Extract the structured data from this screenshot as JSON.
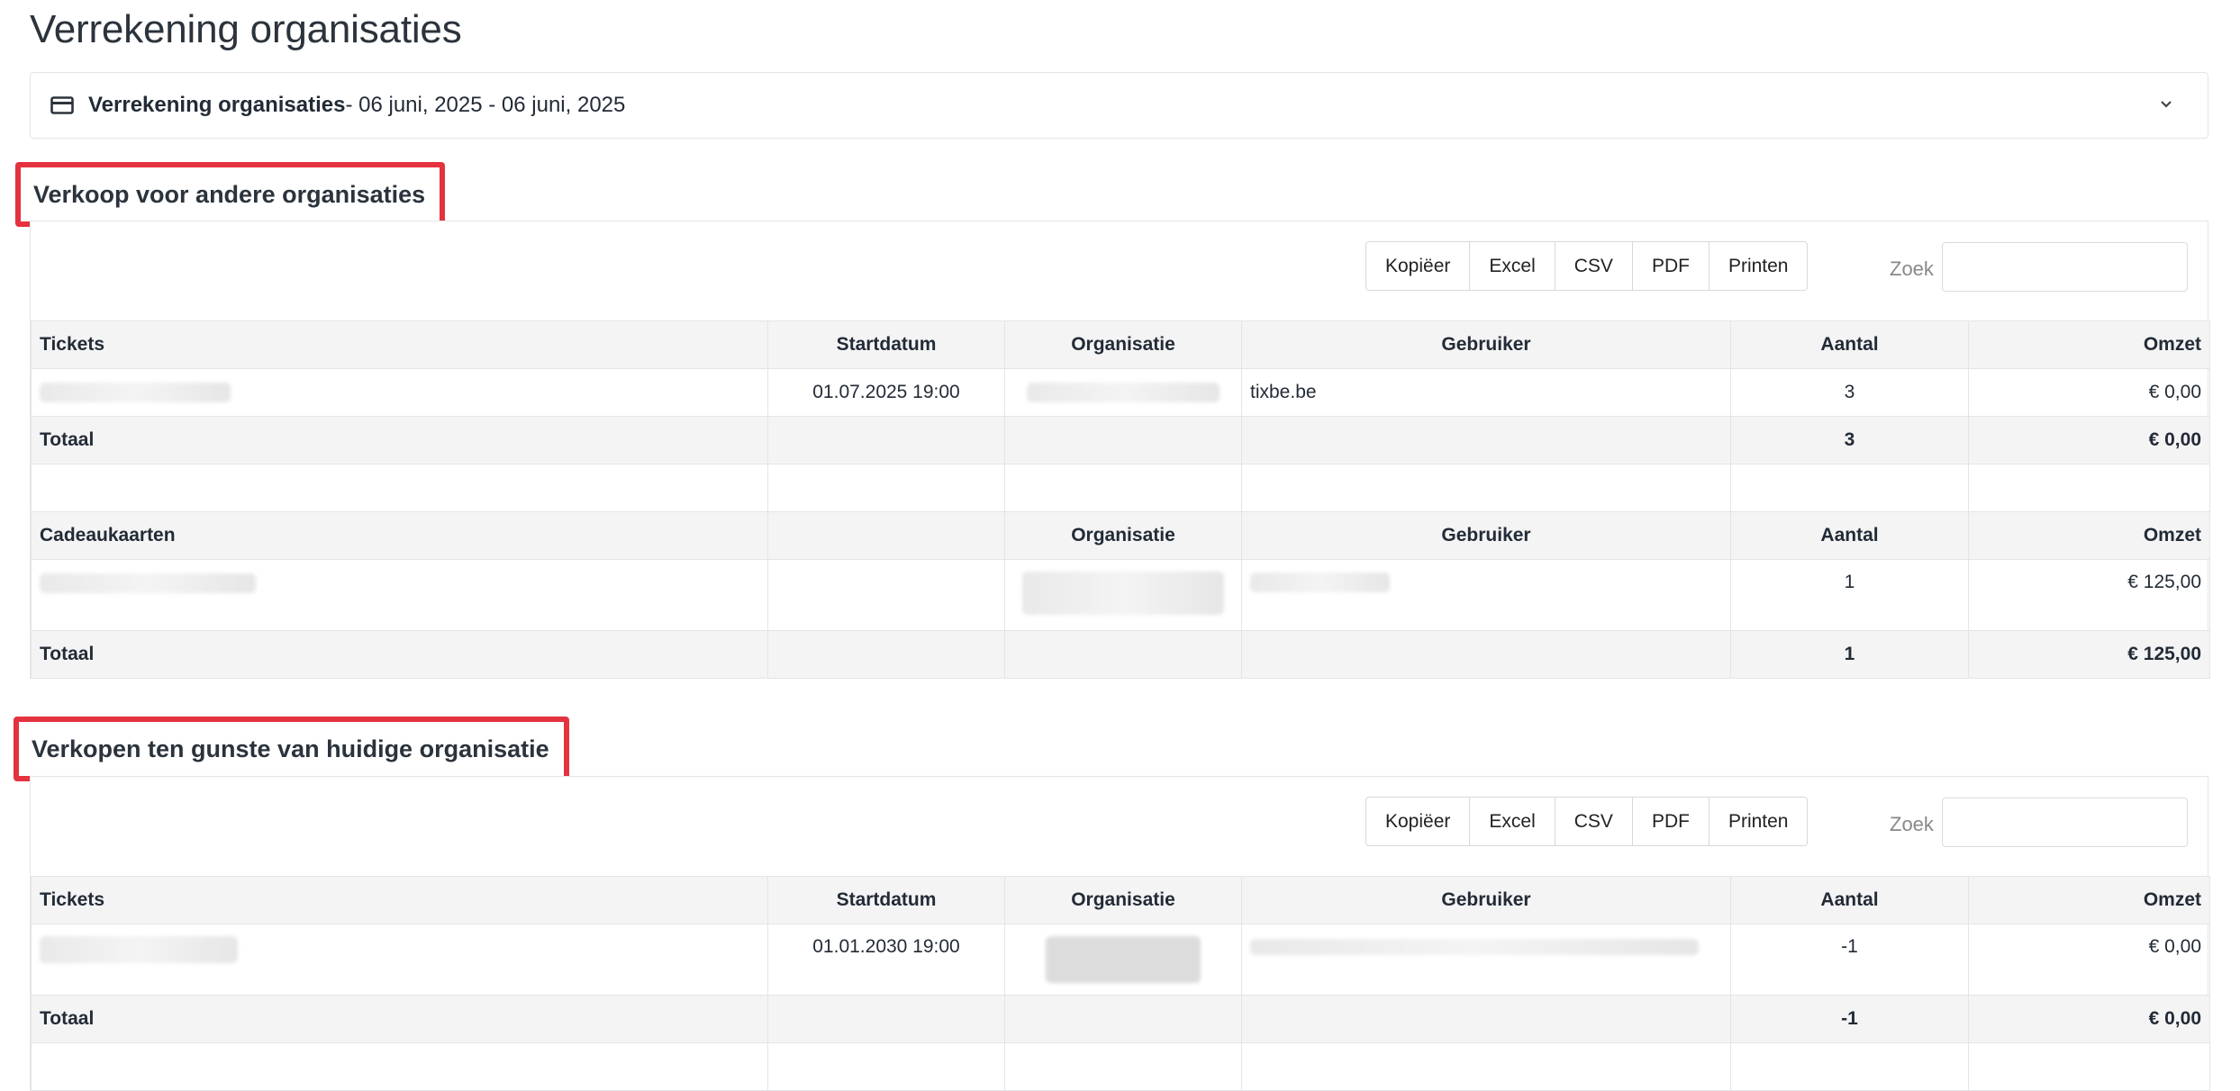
{
  "page_title": "Verrekening organisaties",
  "summary": {
    "title": "Verrekening organisaties",
    "range": " - 06 juni, 2025 - 06 juni, 2025",
    "icon": "credit-card-icon"
  },
  "toolbar": {
    "buttons": [
      "Kopiëer",
      "Excel",
      "CSV",
      "PDF",
      "Printen"
    ],
    "search_label": "Zoek",
    "search_placeholder": ""
  },
  "section1": {
    "title": "Verkoop voor andere organisaties",
    "tickets": {
      "headers": [
        "Tickets",
        "Startdatum",
        "Organisatie",
        "Gebruiker",
        "Aantal",
        "Omzet"
      ],
      "rows": [
        {
          "ticket": "",
          "start": "01.07.2025 19:00",
          "org": "",
          "user": "tixbe.be",
          "aantal": "3",
          "omzet": "€ 0,00"
        }
      ],
      "total": {
        "label": "Totaal",
        "aantal": "3",
        "omzet": "€ 0,00"
      }
    },
    "giftcards": {
      "headers": [
        "Cadeaukaarten",
        "",
        "Organisatie",
        "Gebruiker",
        "Aantal",
        "Omzet"
      ],
      "rows": [
        {
          "card": "",
          "org": "",
          "user": "",
          "aantal": "1",
          "omzet": "€ 125,00"
        }
      ],
      "total": {
        "label": "Totaal",
        "aantal": "1",
        "omzet": "€ 125,00"
      }
    }
  },
  "section2": {
    "title": "Verkopen ten gunste van huidige organisatie",
    "tickets": {
      "headers": [
        "Tickets",
        "Startdatum",
        "Organisatie",
        "Gebruiker",
        "Aantal",
        "Omzet"
      ],
      "rows": [
        {
          "ticket": "",
          "start": "01.01.2030 19:00",
          "org": "",
          "user": "",
          "aantal": "-1",
          "omzet": "€ 0,00"
        }
      ],
      "total": {
        "label": "Totaal",
        "aantal": "-1",
        "omzet": "€ 0,00"
      }
    }
  }
}
